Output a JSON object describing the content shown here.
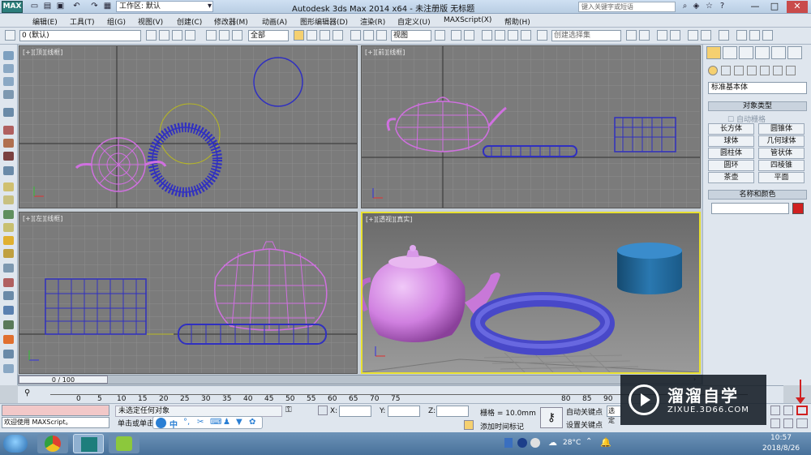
{
  "titlebar": {
    "logo": "MAX",
    "workspace_label": "工作区: 默认",
    "window_title": "Autodesk 3ds Max  2014 x64   - 未注册版   无标题",
    "search_placeholder": "键入关键字或短语"
  },
  "menubar": {
    "items": [
      "编辑(E)",
      "工具(T)",
      "组(G)",
      "视图(V)",
      "创建(C)",
      "修改器(M)",
      "动画(A)",
      "图形编辑器(D)",
      "渲染(R)",
      "自定义(U)",
      "MAXScript(X)",
      "帮助(H)"
    ]
  },
  "toolbar": {
    "layer_select": "0 (默认)",
    "filter_select": "全部",
    "refcoord_select": "视图",
    "selection_set": "创建选择集"
  },
  "viewports": {
    "top": "[+][顶][线框]",
    "front": "[+][前][线框]",
    "left": "[+][左][线框]",
    "persp": "[+][透视][真实]"
  },
  "cmdpanel": {
    "category_select": "标准基本体",
    "object_type_header": "对象类型",
    "autogrid_label": "自动栅格",
    "object_buttons": [
      "长方体",
      "圆锥体",
      "球体",
      "几何球体",
      "圆柱体",
      "管状体",
      "圆环",
      "四棱锥",
      "茶壶",
      "平面"
    ],
    "name_color_header": "名称和颜色",
    "swatch_color": "#d02020"
  },
  "timeline": {
    "frame_label": "0 / 100",
    "ticks": [
      "0",
      "5",
      "10",
      "15",
      "20",
      "25",
      "30",
      "35",
      "40",
      "45",
      "50",
      "55",
      "60",
      "65",
      "70",
      "75",
      "80",
      "85",
      "90"
    ]
  },
  "statusbar": {
    "maxscript_prompt": "欢迎使用 MAXScript。",
    "selection_status": "未选定任何对象",
    "hint": "单击或单击",
    "x_label": "X:",
    "y_label": "Y:",
    "z_label": "Z:",
    "grid_label": "栅格 = 10.0mm",
    "autokey_label": "自动关键点",
    "setkey_label": "设置关键点",
    "selected_label": "选定",
    "add_time_tag": "添加时间标记"
  },
  "taskbar": {
    "temperature": "28°C",
    "time": "10:57",
    "date": "2018/8/26"
  },
  "watermark": {
    "brand": "溜溜自学",
    "url": "ZIXUE.3D66.COM"
  },
  "ime": {
    "label": "中"
  },
  "colors": {
    "teapot": "#d070e0",
    "torus": "#3030c0",
    "cylinder": "#1e5f8c",
    "active_border": "#e8e030"
  }
}
